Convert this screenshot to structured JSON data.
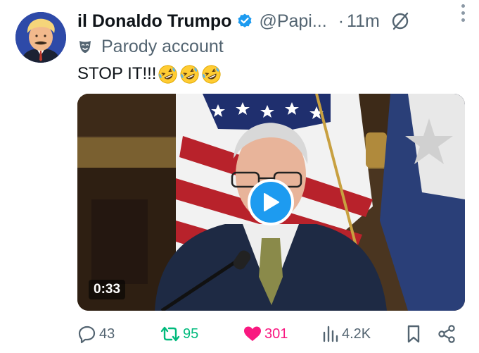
{
  "post": {
    "display_name": "il Donaldo Trumpo",
    "handle": "@Papi...",
    "separator": "·",
    "time": "11m",
    "parody_label": "Parody account",
    "text": "STOP IT!!!",
    "emojis": [
      "rolling-on-floor-laughing",
      "rolling-on-floor-laughing",
      "rolling-on-floor-laughing"
    ],
    "video_duration": "0:33"
  },
  "actions": {
    "replies": "43",
    "reposts": "95",
    "likes": "301",
    "views": "4.2K"
  },
  "colors": {
    "verified": "#1d9bf0",
    "repost": "#00ba7c",
    "like": "#f91880",
    "secondary_text": "#536471",
    "play_button": "#1d9bf0"
  },
  "icons": [
    "verified-badge-icon",
    "muted-icon",
    "more-options-icon",
    "parody-mask-icon",
    "play-icon",
    "reply-icon",
    "repost-icon",
    "like-icon",
    "views-icon",
    "bookmark-icon",
    "share-icon"
  ]
}
